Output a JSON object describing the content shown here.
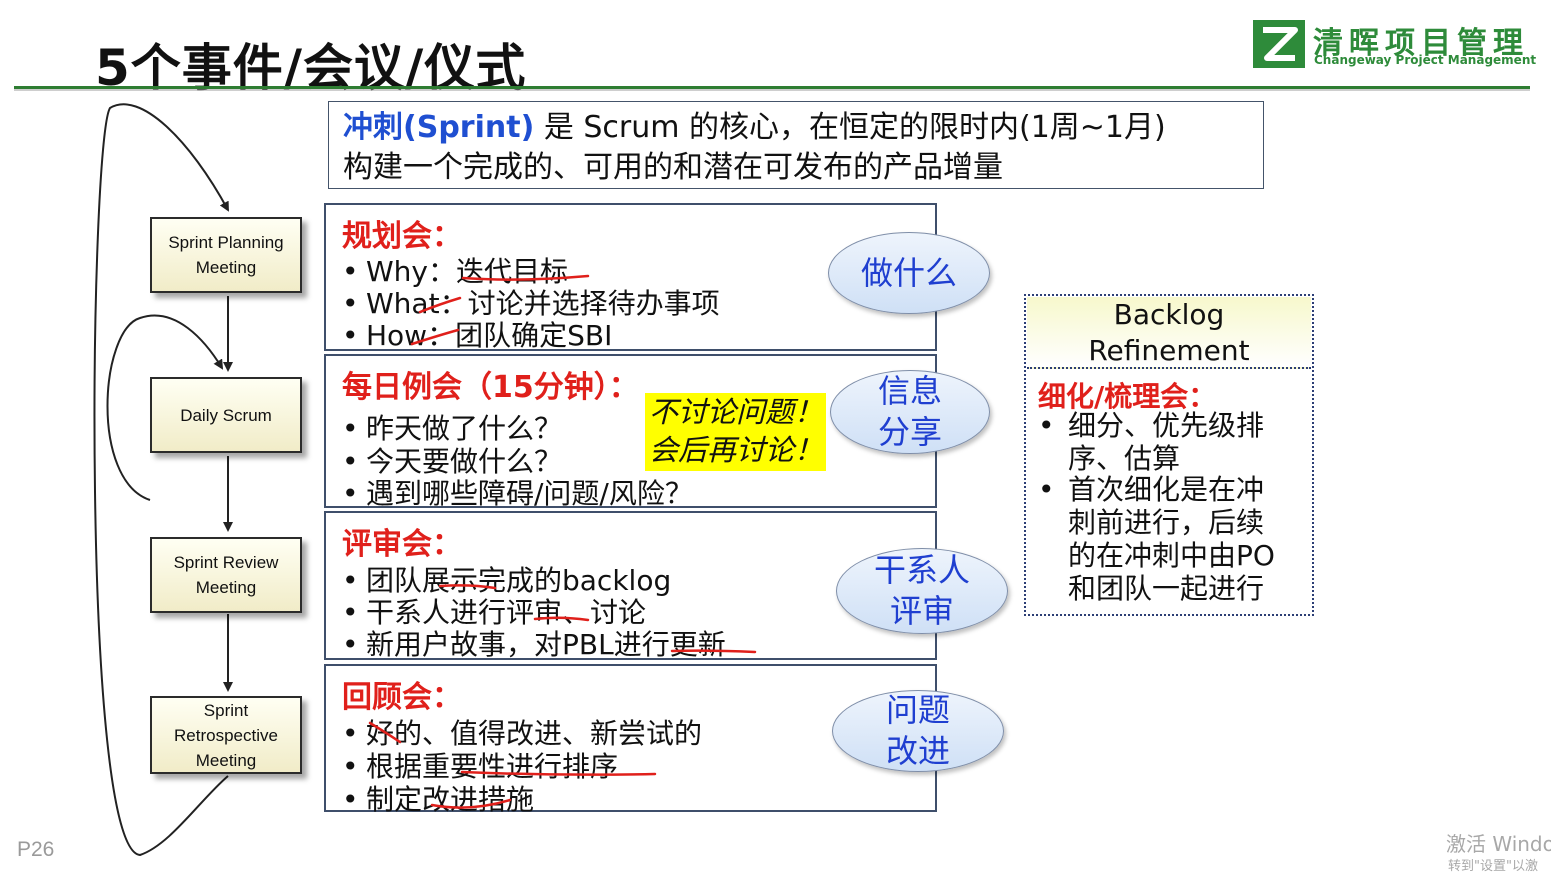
{
  "title": "5个事件/会议/仪式",
  "logo": {
    "cn": "清晖项目管理",
    "en": "Changeway Project Management",
    "icon": "changeway-logo-icon"
  },
  "sprint_definition": {
    "keyword": "冲刺(Sprint)",
    "line1_rest": " 是 Scrum 的核心，在恒定的限时内(1周~1月)",
    "line2": "构建一个完成的、可用的和潜在可发布的产品增量"
  },
  "flow": [
    {
      "label_lines": [
        "Sprint Planning",
        "Meeting"
      ]
    },
    {
      "label_lines": [
        "Daily Scrum"
      ]
    },
    {
      "label_lines": [
        "Sprint Review",
        "Meeting"
      ]
    },
    {
      "label_lines": [
        "Sprint",
        "Retrospective",
        "Meeting"
      ]
    }
  ],
  "panels": [
    {
      "heading": "规划会：",
      "bullets": [
        "Why：迭代目标",
        "What：讨论并选择待办事项",
        "How：团队确定SBI"
      ],
      "tag_lines": [
        "做什么"
      ]
    },
    {
      "heading": "每日例会（15分钟）：",
      "bullets": [
        "昨天做了什么？",
        "今天要做什么？",
        "遇到哪些障碍/问题/风险？"
      ],
      "tag_lines": [
        "信息",
        "分享"
      ]
    },
    {
      "heading": "评审会：",
      "bullets": [
        "团队展示完成的backlog",
        "干系人进行评审、讨论",
        "新用户故事，对PBL进行更新"
      ],
      "tag_lines": [
        "干系人",
        "评审"
      ]
    },
    {
      "heading": "回顾会：",
      "bullets": [
        "好的、值得改进、新尝试的",
        "根据重要性进行排序",
        "制定改进措施"
      ],
      "tag_lines": [
        "问题",
        "改进"
      ]
    }
  ],
  "note": {
    "line1": "不讨论问题！",
    "line2": "会后再讨论！"
  },
  "backlog": {
    "title_line1": "Backlog",
    "title_line2": "Refinement",
    "heading": "细化/梳理会：",
    "bullets": [
      {
        "lines": [
          "细分、优先级排",
          "序、估算"
        ]
      },
      {
        "lines": [
          "首次细化是在冲",
          "刺前进行，后续",
          "的在冲刺中由PO",
          "和团队一起进行"
        ]
      }
    ]
  },
  "page_number": "P26",
  "watermark": {
    "line1": "激活 Windo",
    "line2": "转到\"设置\"以激"
  },
  "colors": {
    "accent_red": "#e0201b",
    "accent_blue": "#1f4fd1",
    "brand_green": "#2e8b3a",
    "note_yellow": "#ffff00"
  }
}
